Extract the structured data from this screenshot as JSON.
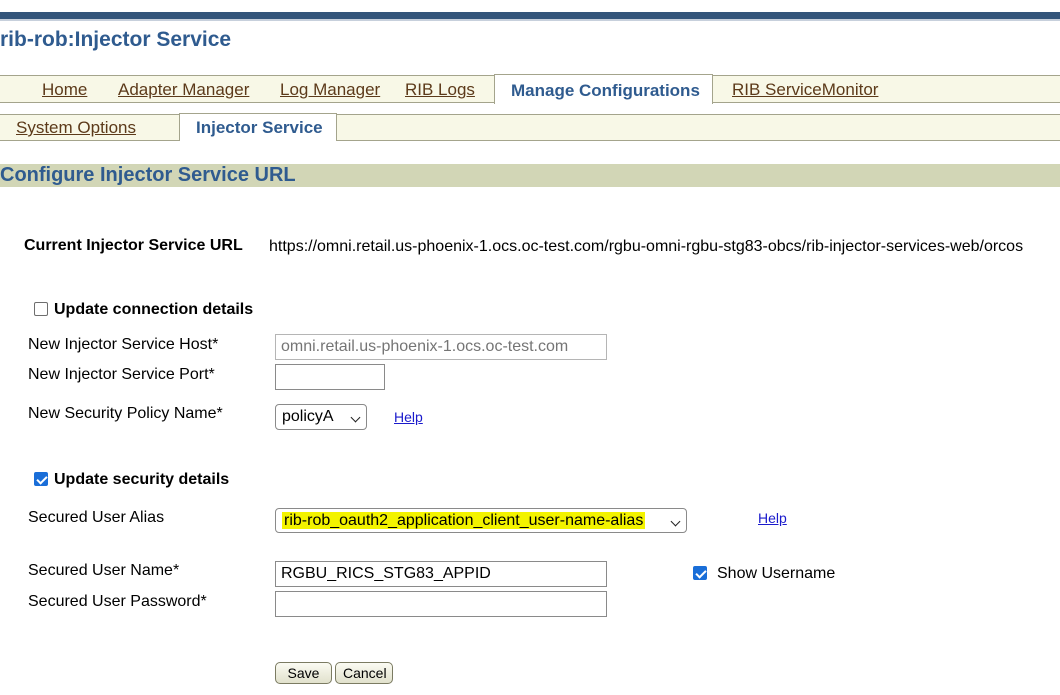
{
  "app": {
    "title": "rib-rob:Injector Service"
  },
  "nav": {
    "tabs": [
      "Home",
      "Adapter Manager",
      "Log Manager",
      "RIB Logs",
      "Manage Configurations",
      "RIB ServiceMonitor"
    ],
    "active_tab": "Manage Configurations",
    "subtabs": [
      "System Options",
      "Injector Service"
    ],
    "active_subtab": "Injector Service"
  },
  "section": {
    "title": "Configure Injector Service URL"
  },
  "current_url": {
    "label": "Current Injector Service URL",
    "value": "https://omni.retail.us-phoenix-1.ocs.oc-test.com/rgbu-omni-rgbu-stg83-obcs/rib-injector-services-web/orcos"
  },
  "connection": {
    "checkbox_label": "Update connection details",
    "checked": false,
    "host_label": "New Injector Service Host*",
    "host_placeholder": "omni.retail.us-phoenix-1.ocs.oc-test.com",
    "host_value": "",
    "port_label": "New Injector Service Port*",
    "port_value": "",
    "policy_label": "New Security Policy Name*",
    "policy_value": "policyA",
    "help_label": "Help"
  },
  "security": {
    "checkbox_label": "Update security details",
    "checked": true,
    "alias_label": "Secured User Alias",
    "alias_value": "rib-rob_oauth2_application_client_user-name-alias",
    "help_label": "Help",
    "username_label": "Secured User Name*",
    "username_value": "RGBU_RICS_STG83_APPID",
    "show_username_label": "Show Username",
    "show_username_checked": true,
    "password_label": "Secured User Password*",
    "password_value": ""
  },
  "actions": {
    "save_label": "Save",
    "cancel_label": "Cancel"
  },
  "colors": {
    "header_blue": "#2f5b8f",
    "top_bar": "#33557a",
    "tab_bg": "#f8f8e7",
    "section_bg": "#d2d6b6",
    "highlight": "#f3f300",
    "checkbox_blue": "#1a6ed8"
  }
}
